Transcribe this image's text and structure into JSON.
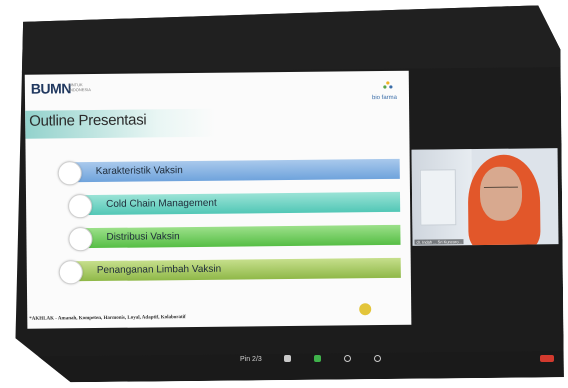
{
  "slide": {
    "logo": "BUMN",
    "logo_sub": "UNTUK INDONESIA",
    "brand": "bio farma",
    "title": "Outline Presentasi",
    "items": [
      {
        "label": "Karakteristik Vaksin"
      },
      {
        "label": "Cold Chain Management"
      },
      {
        "label": "Distribusi Vaksin"
      },
      {
        "label": "Penanganan Limbah Vaksin"
      }
    ],
    "footer": "*AKHLAK - Amanah, Kompeten, Harmonis, Loyal, Adaptif, Kolaboratif"
  },
  "video": {
    "participant_name": "dr. Indah ... Sri Kuncoro..."
  },
  "toolbar": {
    "zoom_label": "Pin 2/3"
  },
  "colors": {
    "row1": "#6fa3dc",
    "row2": "#52c7b6",
    "row3": "#56be45",
    "row4": "#8fb848",
    "hijab": "#e2572a",
    "end_button": "#d23a2e"
  }
}
